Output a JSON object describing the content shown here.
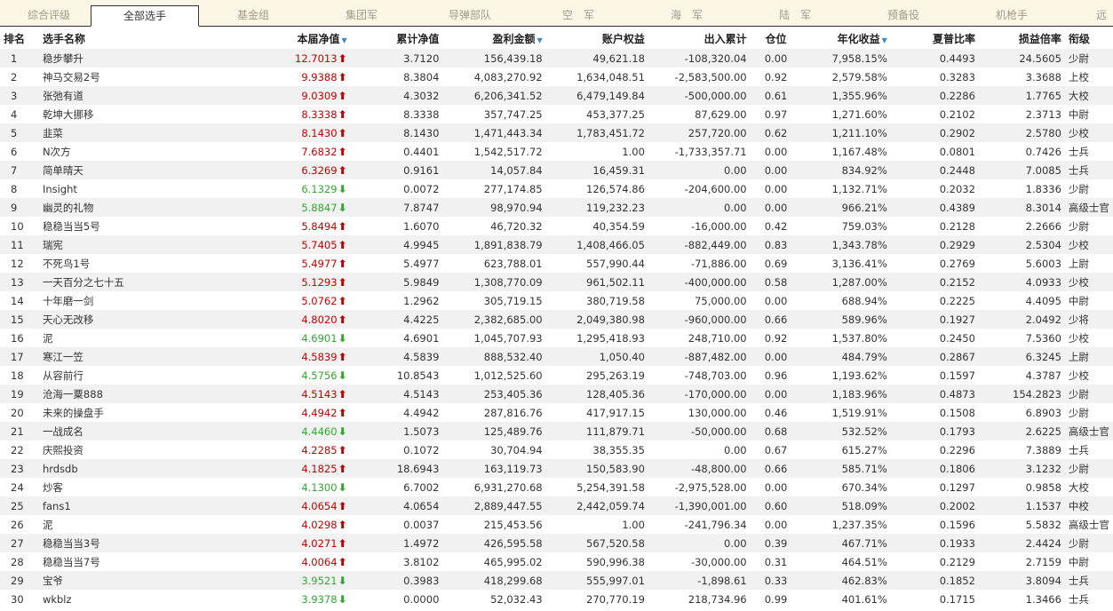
{
  "tabs": [
    "综合评级",
    "全部选手",
    "基金组",
    "集团军",
    "导弹部队",
    "空　军",
    "海　军",
    "陆　军",
    "预备役",
    "机枪手",
    "远"
  ],
  "active_tab": 1,
  "columns": [
    "排名",
    "选手名称",
    "本届净值",
    "累计净值",
    "盈利金额",
    "账户权益",
    "出入累计",
    "仓位",
    "年化收益",
    "夏普比率",
    "损益倍率",
    "衔级"
  ],
  "sort_icon": "sort-down-icon",
  "colors": {
    "up": "#c00000",
    "down": "#2eaa2e"
  },
  "rows": [
    {
      "rank": "1",
      "name": "稳步攀升",
      "nav": "12.7013",
      "dir": "up",
      "cum": "3.7120",
      "profit": "156,439.18",
      "equity": "49,621.18",
      "flow": "-108,320.04",
      "pos": "0.00",
      "annual": "7,958.15%",
      "sharpe": "0.4493",
      "pl": "24.5605",
      "grade": "少尉"
    },
    {
      "rank": "2",
      "name": "神马交易2号",
      "nav": "9.9388",
      "dir": "up",
      "cum": "8.3804",
      "profit": "4,083,270.92",
      "equity": "1,634,048.51",
      "flow": "-2,583,500.00",
      "pos": "0.92",
      "annual": "2,579.58%",
      "sharpe": "0.3283",
      "pl": "3.3688",
      "grade": "上校"
    },
    {
      "rank": "3",
      "name": "张弛有道",
      "nav": "9.0309",
      "dir": "up",
      "cum": "4.3032",
      "profit": "6,206,341.52",
      "equity": "6,479,149.84",
      "flow": "-500,000.00",
      "pos": "0.61",
      "annual": "1,355.96%",
      "sharpe": "0.2286",
      "pl": "1.7765",
      "grade": "大校"
    },
    {
      "rank": "4",
      "name": "乾坤大挪移",
      "nav": "8.3338",
      "dir": "up",
      "cum": "8.3338",
      "profit": "357,747.25",
      "equity": "453,377.25",
      "flow": "87,629.00",
      "pos": "0.97",
      "annual": "1,271.60%",
      "sharpe": "0.2102",
      "pl": "2.3713",
      "grade": "中尉"
    },
    {
      "rank": "5",
      "name": "韭菜",
      "nav": "8.1430",
      "dir": "up",
      "cum": "8.1430",
      "profit": "1,471,443.34",
      "equity": "1,783,451.72",
      "flow": "257,720.00",
      "pos": "0.62",
      "annual": "1,211.10%",
      "sharpe": "0.2902",
      "pl": "2.5780",
      "grade": "少校"
    },
    {
      "rank": "6",
      "name": "N次方",
      "nav": "7.6832",
      "dir": "up",
      "cum": "0.4401",
      "profit": "1,542,517.72",
      "equity": "1.00",
      "flow": "-1,733,357.71",
      "pos": "0.00",
      "annual": "1,167.48%",
      "sharpe": "0.0801",
      "pl": "0.7426",
      "grade": "士兵"
    },
    {
      "rank": "7",
      "name": "简单晴天",
      "nav": "6.3269",
      "dir": "up",
      "cum": "0.9161",
      "profit": "14,057.84",
      "equity": "16,459.31",
      "flow": "0.00",
      "pos": "0.00",
      "annual": "834.92%",
      "sharpe": "0.2448",
      "pl": "7.0085",
      "grade": "士兵"
    },
    {
      "rank": "8",
      "name": "Insight",
      "nav": "6.1329",
      "dir": "down",
      "cum": "0.0072",
      "profit": "277,174.85",
      "equity": "126,574.86",
      "flow": "-204,600.00",
      "pos": "0.00",
      "annual": "1,132.71%",
      "sharpe": "0.2032",
      "pl": "1.8336",
      "grade": "少尉"
    },
    {
      "rank": "9",
      "name": "幽灵的礼物",
      "nav": "5.8847",
      "dir": "down",
      "cum": "7.8747",
      "profit": "98,970.94",
      "equity": "119,232.23",
      "flow": "0.00",
      "pos": "0.00",
      "annual": "966.21%",
      "sharpe": "0.4389",
      "pl": "8.3014",
      "grade": "高级士官"
    },
    {
      "rank": "10",
      "name": "稳稳当当5号",
      "nav": "5.8494",
      "dir": "up",
      "cum": "1.6070",
      "profit": "46,720.32",
      "equity": "40,354.59",
      "flow": "-16,000.00",
      "pos": "0.42",
      "annual": "759.03%",
      "sharpe": "0.2128",
      "pl": "2.2666",
      "grade": "少尉"
    },
    {
      "rank": "11",
      "name": "瑞宪",
      "nav": "5.7405",
      "dir": "up",
      "cum": "4.9945",
      "profit": "1,891,838.79",
      "equity": "1,408,466.05",
      "flow": "-882,449.00",
      "pos": "0.83",
      "annual": "1,343.78%",
      "sharpe": "0.2929",
      "pl": "2.5304",
      "grade": "少校"
    },
    {
      "rank": "12",
      "name": "不死鸟1号",
      "nav": "5.4977",
      "dir": "up",
      "cum": "5.4977",
      "profit": "623,788.01",
      "equity": "557,990.44",
      "flow": "-71,886.00",
      "pos": "0.69",
      "annual": "3,136.41%",
      "sharpe": "0.2769",
      "pl": "5.6003",
      "grade": "上尉"
    },
    {
      "rank": "13",
      "name": "一天百分之七十五",
      "nav": "5.1293",
      "dir": "up",
      "cum": "5.9849",
      "profit": "1,308,770.09",
      "equity": "961,502.11",
      "flow": "-400,000.00",
      "pos": "0.58",
      "annual": "1,287.00%",
      "sharpe": "0.2152",
      "pl": "4.0933",
      "grade": "少校"
    },
    {
      "rank": "14",
      "name": "十年磨一剑",
      "nav": "5.0762",
      "dir": "up",
      "cum": "1.2962",
      "profit": "305,719.15",
      "equity": "380,719.58",
      "flow": "75,000.00",
      "pos": "0.00",
      "annual": "688.94%",
      "sharpe": "0.2225",
      "pl": "4.4095",
      "grade": "中尉"
    },
    {
      "rank": "15",
      "name": "天心无改移",
      "nav": "4.8020",
      "dir": "up",
      "cum": "4.4225",
      "profit": "2,382,685.00",
      "equity": "2,049,380.98",
      "flow": "-960,000.00",
      "pos": "0.66",
      "annual": "589.96%",
      "sharpe": "0.1927",
      "pl": "2.0492",
      "grade": "少将"
    },
    {
      "rank": "16",
      "name": "泥",
      "nav": "4.6901",
      "dir": "down",
      "cum": "4.6901",
      "profit": "1,045,707.93",
      "equity": "1,295,418.93",
      "flow": "248,710.00",
      "pos": "0.92",
      "annual": "1,537.80%",
      "sharpe": "0.2450",
      "pl": "7.5360",
      "grade": "少校"
    },
    {
      "rank": "17",
      "name": "寒江一笠",
      "nav": "4.5839",
      "dir": "up",
      "cum": "4.5839",
      "profit": "888,532.40",
      "equity": "1,050.40",
      "flow": "-887,482.00",
      "pos": "0.00",
      "annual": "484.79%",
      "sharpe": "0.2867",
      "pl": "6.3245",
      "grade": "上尉"
    },
    {
      "rank": "18",
      "name": "从容前行",
      "nav": "4.5756",
      "dir": "down",
      "cum": "10.8543",
      "profit": "1,012,525.60",
      "equity": "295,263.19",
      "flow": "-748,703.00",
      "pos": "0.96",
      "annual": "1,193.62%",
      "sharpe": "0.1597",
      "pl": "4.3787",
      "grade": "少校"
    },
    {
      "rank": "19",
      "name": "沧海一粟888",
      "nav": "4.5143",
      "dir": "up",
      "cum": "4.5143",
      "profit": "253,405.36",
      "equity": "128,405.36",
      "flow": "-170,000.00",
      "pos": "0.00",
      "annual": "1,183.96%",
      "sharpe": "0.4873",
      "pl": "154.2823",
      "grade": "少尉"
    },
    {
      "rank": "20",
      "name": "未来的操盘手",
      "nav": "4.4942",
      "dir": "up",
      "cum": "4.4942",
      "profit": "287,816.76",
      "equity": "417,917.15",
      "flow": "130,000.00",
      "pos": "0.46",
      "annual": "1,519.91%",
      "sharpe": "0.1508",
      "pl": "6.8903",
      "grade": "少尉"
    },
    {
      "rank": "21",
      "name": "一战成名",
      "nav": "4.4460",
      "dir": "down",
      "cum": "1.5073",
      "profit": "125,489.76",
      "equity": "111,879.71",
      "flow": "-50,000.00",
      "pos": "0.68",
      "annual": "532.52%",
      "sharpe": "0.1793",
      "pl": "2.6225",
      "grade": "高级士官"
    },
    {
      "rank": "22",
      "name": "庆熙投资",
      "nav": "4.2285",
      "dir": "up",
      "cum": "0.1072",
      "profit": "30,704.94",
      "equity": "38,355.35",
      "flow": "0.00",
      "pos": "0.67",
      "annual": "615.27%",
      "sharpe": "0.2296",
      "pl": "7.3889",
      "grade": "士兵"
    },
    {
      "rank": "23",
      "name": "hrdsdb",
      "nav": "4.1825",
      "dir": "up",
      "cum": "18.6943",
      "profit": "163,119.73",
      "equity": "150,583.90",
      "flow": "-48,800.00",
      "pos": "0.66",
      "annual": "585.71%",
      "sharpe": "0.1806",
      "pl": "3.1232",
      "grade": "少尉"
    },
    {
      "rank": "24",
      "name": "炒客",
      "nav": "4.1300",
      "dir": "down",
      "cum": "6.7002",
      "profit": "6,931,270.68",
      "equity": "5,254,391.58",
      "flow": "-2,975,528.00",
      "pos": "0.00",
      "annual": "670.34%",
      "sharpe": "0.1297",
      "pl": "0.9858",
      "grade": "大校"
    },
    {
      "rank": "25",
      "name": "fans1",
      "nav": "4.0654",
      "dir": "up",
      "cum": "4.0654",
      "profit": "2,889,447.55",
      "equity": "2,442,059.74",
      "flow": "-1,390,001.00",
      "pos": "0.60",
      "annual": "518.09%",
      "sharpe": "0.2002",
      "pl": "1.1537",
      "grade": "中校"
    },
    {
      "rank": "26",
      "name": "泥",
      "nav": "4.0298",
      "dir": "up",
      "cum": "0.0037",
      "profit": "215,453.56",
      "equity": "1.00",
      "flow": "-241,796.34",
      "pos": "0.00",
      "annual": "1,237.35%",
      "sharpe": "0.1596",
      "pl": "5.5832",
      "grade": "高级士官"
    },
    {
      "rank": "27",
      "name": "稳稳当当3号",
      "nav": "4.0271",
      "dir": "up",
      "cum": "1.4972",
      "profit": "426,595.58",
      "equity": "567,520.58",
      "flow": "0.00",
      "pos": "0.39",
      "annual": "467.71%",
      "sharpe": "0.1933",
      "pl": "2.4424",
      "grade": "少尉"
    },
    {
      "rank": "28",
      "name": "稳稳当当7号",
      "nav": "4.0064",
      "dir": "up",
      "cum": "3.8102",
      "profit": "465,995.02",
      "equity": "590,996.38",
      "flow": "-30,000.00",
      "pos": "0.31",
      "annual": "464.51%",
      "sharpe": "0.2129",
      "pl": "2.7159",
      "grade": "中尉"
    },
    {
      "rank": "29",
      "name": "宝爷",
      "nav": "3.9521",
      "dir": "down",
      "cum": "0.3983",
      "profit": "418,299.68",
      "equity": "555,997.01",
      "flow": "-1,898.61",
      "pos": "0.33",
      "annual": "462.83%",
      "sharpe": "0.1852",
      "pl": "3.8094",
      "grade": "士兵"
    },
    {
      "rank": "30",
      "name": "wkblz",
      "nav": "3.9378",
      "dir": "down",
      "cum": "0.0000",
      "profit": "52,032.43",
      "equity": "270,770.19",
      "flow": "218,734.96",
      "pos": "0.99",
      "annual": "401.61%",
      "sharpe": "0.1715",
      "pl": "1.3466",
      "grade": "士兵"
    }
  ]
}
